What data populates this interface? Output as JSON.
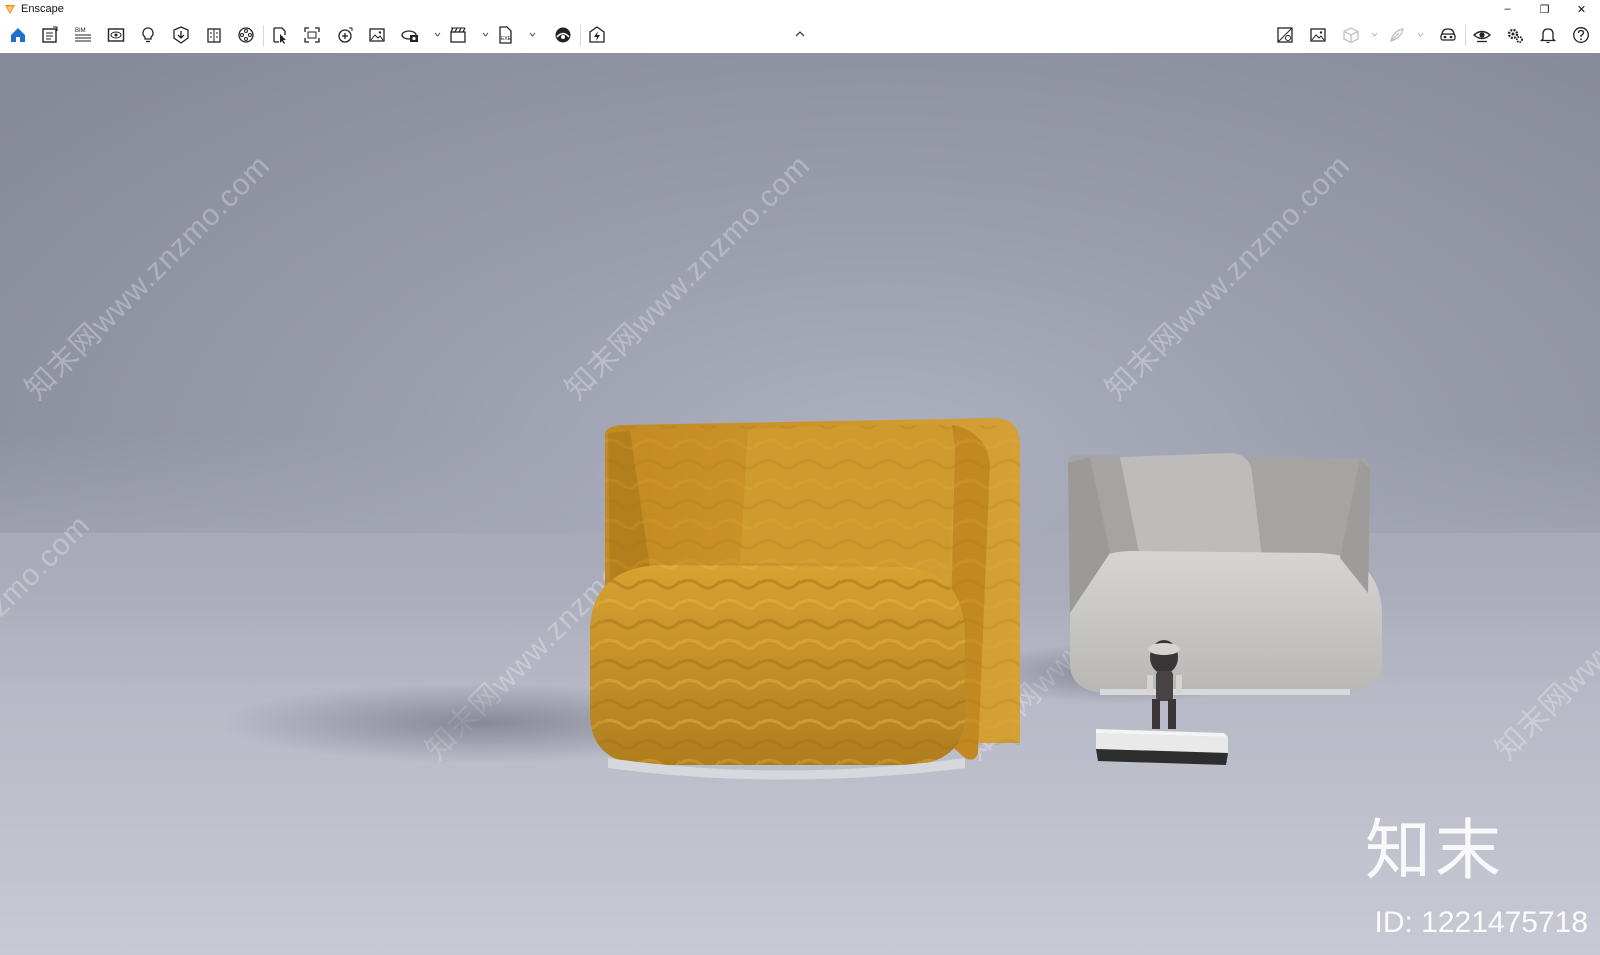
{
  "window": {
    "title": "Enscape",
    "controls": {
      "minimize": "–",
      "restore": "❐",
      "close": "✕"
    }
  },
  "toolbar": {
    "left_icons": [
      "home-icon",
      "screenshot-editor-icon",
      "bim-icon",
      "views-icon",
      "light-icon",
      "asset-library-icon",
      "material-editor-icon",
      "video-editor-icon",
      "select-icon",
      "capture-icon",
      "batch-render-icon",
      "image-icon",
      "panorama-icon",
      "export-video-icon",
      "export-exe-icon",
      "atmosphere-icon",
      "live-link-icon"
    ],
    "right_icons": [
      "visual-settings-icon",
      "rendered-image-icon",
      "cube-icon",
      "feather-icon",
      "vr-headset-icon",
      "eye-icon",
      "settings-icon",
      "notifications-icon",
      "help-icon"
    ]
  },
  "viewport": {
    "watermark_text": "知末网www.znzmo.com",
    "brand_text": "知末",
    "image_id": "ID: 1221475718"
  },
  "colors": {
    "toolbar_bg": "#ffffff",
    "accent": "#1f6fd1",
    "sofa_yellow": "#c99227",
    "sofa_gray": "#c9c8c6"
  }
}
